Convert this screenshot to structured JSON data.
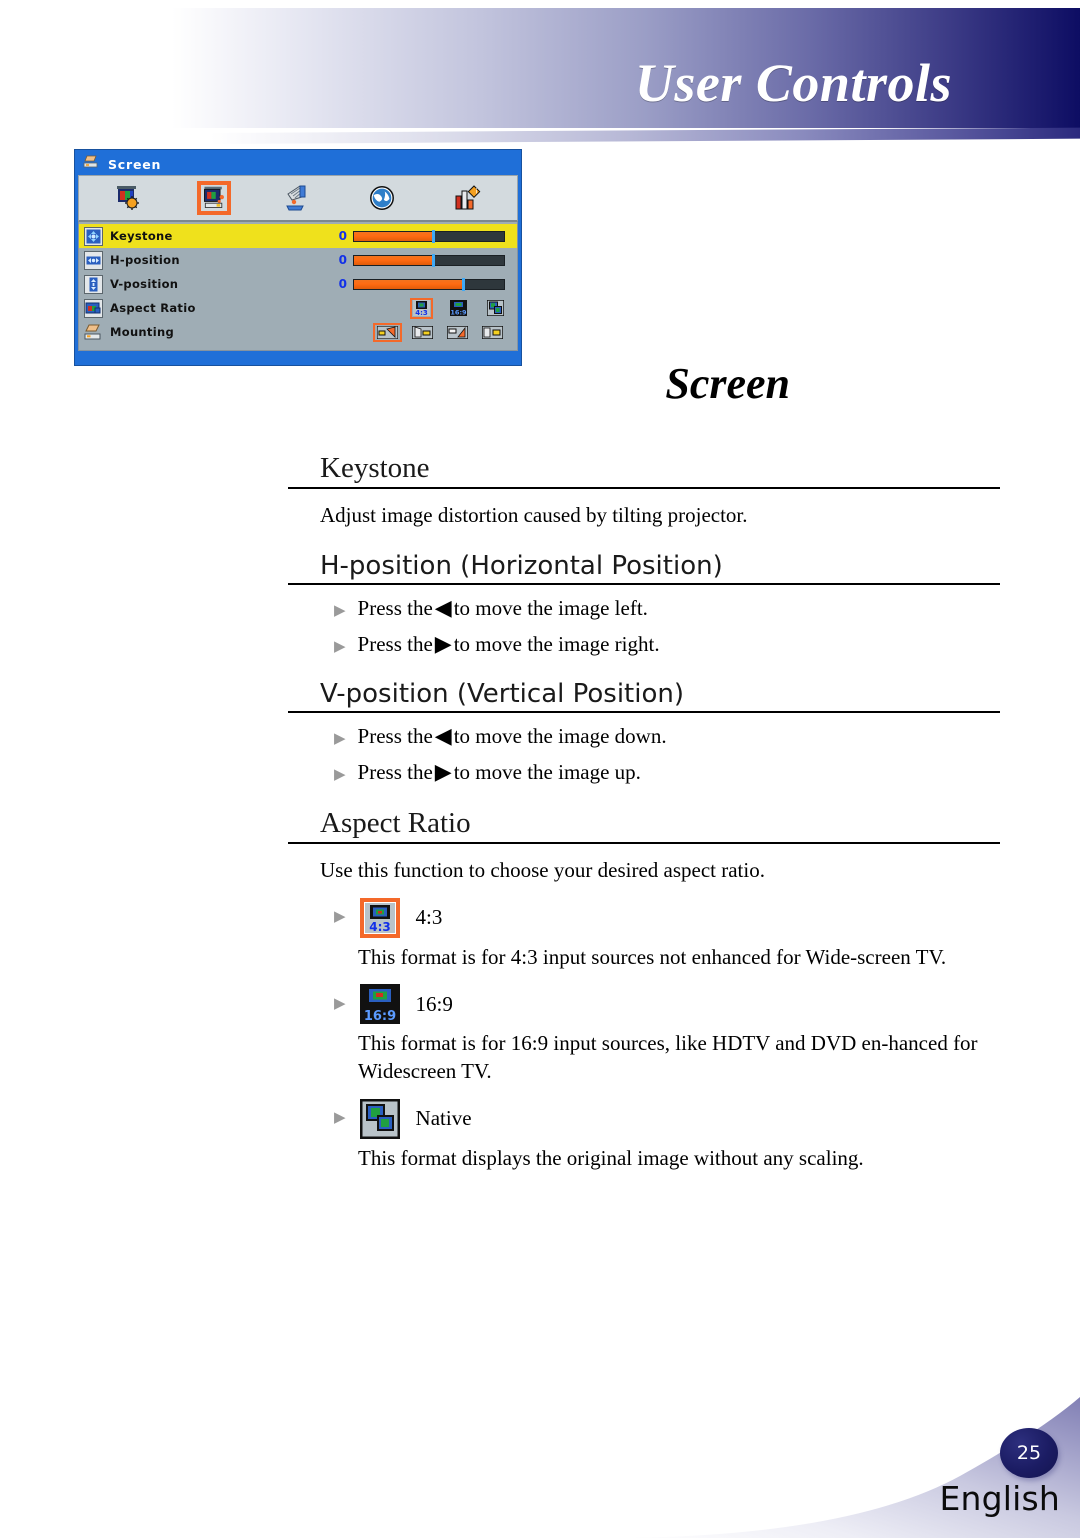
{
  "header": {
    "title": "User Controls"
  },
  "osd": {
    "window_title": "Screen",
    "title_icon": "mounting-icon",
    "toolbar": [
      {
        "name": "image-icon",
        "label": "Image",
        "selected": false
      },
      {
        "name": "screen-icon",
        "label": "Screen",
        "selected": true
      },
      {
        "name": "setup-icon",
        "label": "Setup",
        "selected": false
      },
      {
        "name": "language-globe-icon",
        "label": "Language",
        "selected": false
      },
      {
        "name": "options-icon",
        "label": "Options",
        "selected": false
      }
    ],
    "rows": [
      {
        "label": "Keystone",
        "icon": "keystone-icon",
        "type": "slider",
        "value": "0",
        "fill_percent": 52,
        "mark_percent": 52,
        "highlight": true
      },
      {
        "label": "H-position",
        "icon": "h-position-icon",
        "type": "slider",
        "value": "0",
        "fill_percent": 52,
        "mark_percent": 52,
        "highlight": false
      },
      {
        "label": "V-position",
        "icon": "v-position-icon",
        "type": "slider",
        "value": "0",
        "fill_percent": 72,
        "mark_percent": 72,
        "highlight": false
      },
      {
        "label": "Aspect Ratio",
        "icon": "aspect-ratio-icon",
        "type": "options",
        "highlight": false
      },
      {
        "label": "Mounting",
        "icon": "mounting-icon",
        "type": "mount-options",
        "highlight": false
      }
    ],
    "aspect_options": [
      {
        "name": "aspect-4-3-option",
        "label": "4:3",
        "selected": true
      },
      {
        "name": "aspect-16-9-option",
        "label": "16:9",
        "selected": false
      },
      {
        "name": "aspect-native-option",
        "label": "Native",
        "selected": false
      }
    ],
    "mount_options": [
      {
        "name": "mount-front-table-option",
        "selected": true
      },
      {
        "name": "mount-rear-table-option",
        "selected": false
      },
      {
        "name": "mount-front-ceiling-option",
        "selected": false
      },
      {
        "name": "mount-rear-ceiling-option",
        "selected": false
      }
    ]
  },
  "page": {
    "heading": "Screen"
  },
  "sections": {
    "keystone": {
      "title": "Keystone",
      "body": "Adjust image distortion caused by tilting projector."
    },
    "hposition": {
      "title": "H-position (Horizontal Position)",
      "bullets": [
        {
          "pre": "Press the",
          "arrow": "◀",
          "post": "to move the image left."
        },
        {
          "pre": "Press the",
          "arrow": "▶",
          "post": "to move the image right."
        }
      ]
    },
    "vposition": {
      "title": "V-position (Vertical Position)",
      "bullets": [
        {
          "pre": "Press the",
          "arrow": "◀",
          "post": "to move the image down."
        },
        {
          "pre": "Press the",
          "arrow": "▶",
          "post": "to move the image up."
        }
      ]
    },
    "aspect": {
      "title": "Aspect Ratio",
      "body": "Use this function to choose your desired aspect ratio.",
      "options": [
        {
          "label": "4:3",
          "icon": "aspect-4-3-icon",
          "selected": true,
          "desc": "This format is for 4:3 input sources not enhanced for Wide-screen TV."
        },
        {
          "label": "16:9",
          "icon": "aspect-16-9-icon",
          "selected": false,
          "desc": "This format is for 16:9 input sources, like HDTV and DVD en-hanced for Widescreen TV."
        },
        {
          "label": "Native",
          "icon": "aspect-native-icon",
          "selected": false,
          "desc": "This format displays the original image without any scaling."
        }
      ]
    }
  },
  "footer": {
    "page_number": "25",
    "language": "English"
  },
  "colors": {
    "banner_dark": "#0d0d63",
    "osd_frame_blue": "#1f6fd8",
    "osd_body_gray": "#9fadb5",
    "highlight_yellow": "#efe11c",
    "slider_orange": "#ff6a12",
    "slider_track": "#2e373c",
    "slider_marker": "#3fa9f5",
    "selection_orange": "#f4692a",
    "value_blue": "#1230e8",
    "bubble_navy": "#1b1c63"
  }
}
